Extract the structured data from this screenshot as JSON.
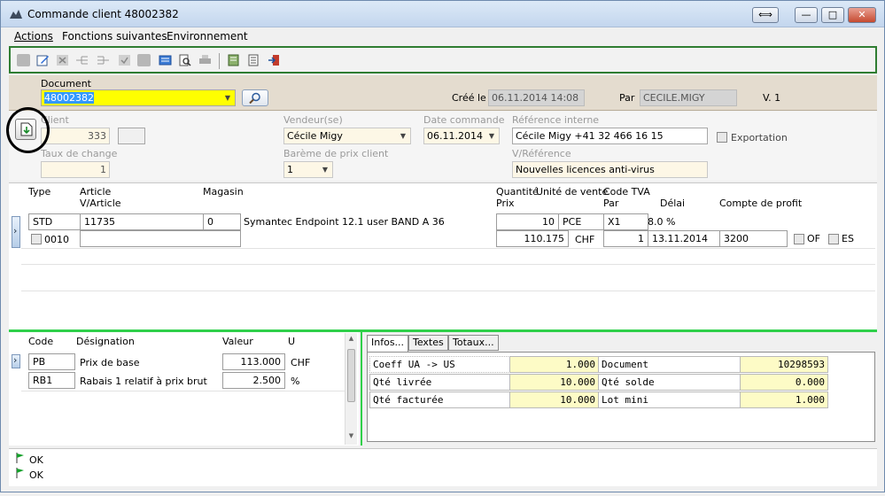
{
  "window": {
    "title": "Commande client 48002382",
    "restore_label": "⟺",
    "minimize_label": "—",
    "maximize_label": "□",
    "close_label": "✕"
  },
  "menu": [
    "Actions",
    "Fonctions suivantes",
    "Environnement"
  ],
  "document": {
    "label": "Document",
    "value": "48002382",
    "created_label": "Créé le",
    "created_value": "06.11.2014 14:08",
    "by_label": "Par",
    "by_value": "CECILE.MIGY",
    "version": "V.  1"
  },
  "client": {
    "client_label": "Client",
    "client_value": "333",
    "exchange_label": "Taux de change",
    "exchange_value": "1",
    "seller_label": "Vendeur(se)",
    "seller_value": "Cécile Migy",
    "price_scale_label": "Barème de prix client",
    "price_scale_value": "1",
    "order_date_label": "Date commande",
    "order_date_value": "06.11.2014",
    "internal_ref_label": "Référence interne",
    "internal_ref_value": "Cécile Migy +41 32 466 16 15",
    "your_ref_label": "V/Référence",
    "your_ref_value": "Nouvelles licences anti-virus",
    "export_label": "Exportation"
  },
  "lines": {
    "headers": {
      "type": "Type",
      "article": "Article",
      "v_article": "V/Article",
      "magasin": "Magasin",
      "quantite": "Quantité",
      "prix": "Prix",
      "unite": "Unité de vente",
      "code_tva": "Code TVA",
      "par": "Par",
      "delai": "Délai",
      "compte": "Compte de profit"
    },
    "row": {
      "type": "STD",
      "article": "11735",
      "magasin": "0",
      "designation": "Symantec Endpoint 12.1 user BAND A 36",
      "quantite": "10",
      "unite": "PCE",
      "code_tva": "X1",
      "taux_tva": "8.0 %",
      "position": "0010",
      "prix": "110.175",
      "devise": "CHF",
      "par": "1",
      "delai": "13.11.2014",
      "compte": "3200",
      "of_label": "OF",
      "es_label": "ES"
    }
  },
  "conditions": {
    "headers": {
      "code": "Code",
      "designation": "Désignation",
      "valeur": "Valeur",
      "unite": "U"
    },
    "rows": [
      {
        "code": "PB",
        "designation": "Prix de base",
        "valeur": "113.000",
        "unite": "CHF"
      },
      {
        "code": "RB1",
        "designation": "Rabais 1 relatif à prix brut",
        "valeur": "2.500",
        "unite": "%"
      }
    ]
  },
  "tabs": [
    "Infos...",
    "Textes",
    "Totaux..."
  ],
  "infos": [
    {
      "label": "Coeff UA -> US",
      "value": "1.000",
      "label2": "Document",
      "value2": "10298593"
    },
    {
      "label": "Qté livrée",
      "value": "10.000",
      "label2": "Qté solde",
      "value2": "0.000"
    },
    {
      "label": "Qté facturée",
      "value": "10.000",
      "label2": "Lot mini",
      "value2": "1.000"
    }
  ],
  "status_messages": [
    "OK",
    "OK"
  ],
  "colors": {
    "highlight_yellow": "#ffff00",
    "selection_blue": "#3399ff",
    "frame_green": "#2f7d32",
    "divider_green": "#2fd04a"
  }
}
